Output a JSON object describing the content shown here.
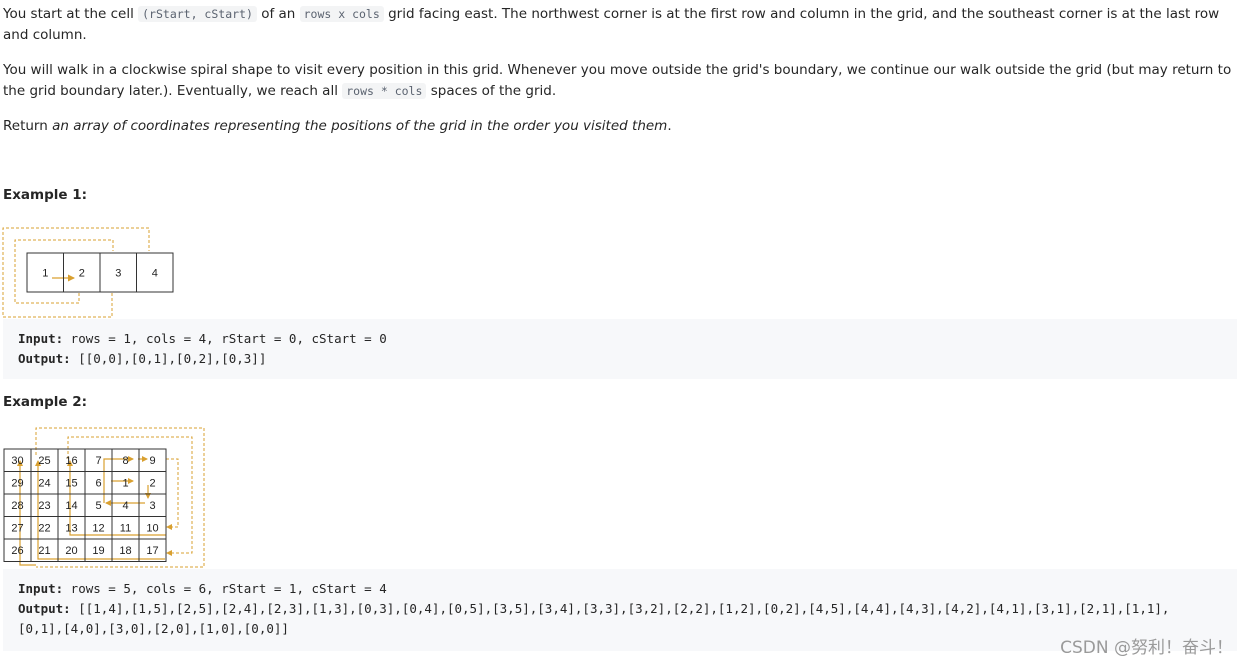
{
  "description": {
    "p1_a": "You start at the cell ",
    "p1_code1": "(rStart, cStart)",
    "p1_b": " of an ",
    "p1_code2": "rows x cols",
    "p1_c": " grid facing east. The northwest corner is at the first row and column in the grid, and the southeast corner is at the last row and column.",
    "p2_a": "You will walk in a clockwise spiral shape to visit every position in this grid. Whenever you move outside the grid's boundary, we continue our walk outside the grid (but may return to the grid boundary later.). Eventually, we reach all ",
    "p2_code": "rows * cols",
    "p2_b": " spaces of the grid.",
    "p3_a": "Return ",
    "p3_italic": "an array of coordinates representing the positions of the grid in the order you visited them",
    "p3_b": "."
  },
  "example1": {
    "heading": "Example 1:",
    "input_label": "Input:",
    "input_value": " rows = 1, cols = 4, rStart = 0, cStart = 0",
    "output_label": "Output:",
    "output_value": " [[0,0],[0,1],[0,2],[0,3]]",
    "grid": [
      [
        "1",
        "2",
        "3",
        "4"
      ]
    ]
  },
  "example2": {
    "heading": "Example 2:",
    "input_label": "Input:",
    "input_value": " rows = 5, cols = 6, rStart = 1, cStart = 4",
    "output_label": "Output:",
    "output_value": " [[1,4],[1,5],[2,5],[2,4],[2,3],[1,3],[0,3],[0,4],[0,5],[3,5],[3,4],[3,3],[3,2],[2,2],[1,2],[0,2],[4,5],[4,4],[4,3],[4,2],[4,1],[3,1],[2,1],[1,1],",
    "output_value_line2": "[0,1],[4,0],[3,0],[2,0],[1,0],[0,0]]",
    "grid": [
      [
        "30",
        "25",
        "16",
        "7",
        "8",
        "9"
      ],
      [
        "29",
        "24",
        "15",
        "6",
        "1",
        "2"
      ],
      [
        "28",
        "23",
        "14",
        "5",
        "4",
        "3"
      ],
      [
        "27",
        "22",
        "13",
        "12",
        "11",
        "10"
      ],
      [
        "26",
        "21",
        "20",
        "19",
        "18",
        "17"
      ]
    ]
  },
  "watermark": "CSDN @努利！奋斗！",
  "colors": {
    "path": "#d9a030",
    "grid_line": "#333333",
    "code_bg": "#f7f8fa"
  }
}
